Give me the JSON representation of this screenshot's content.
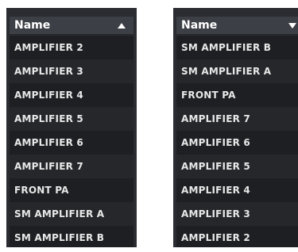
{
  "left_list": {
    "header_label": "Name",
    "sort": "ascending",
    "items": [
      "AMPLIFIER 2",
      "AMPLIFIER 3",
      "AMPLIFIER 4",
      "AMPLIFIER 5",
      "AMPLIFIER 6",
      "AMPLIFIER 7",
      "FRONT PA",
      "SM AMPLIFIER A",
      "SM AMPLIFIER B"
    ]
  },
  "right_list": {
    "header_label": "Name",
    "sort": "descending",
    "items": [
      "SM AMPLIFIER B",
      "SM AMPLIFIER A",
      "FRONT PA",
      "AMPLIFIER 7",
      "AMPLIFIER 6",
      "AMPLIFIER 5",
      "AMPLIFIER 4",
      "AMPLIFIER 3",
      "AMPLIFIER 2"
    ]
  },
  "colors": {
    "panel_background": "#2a2c31",
    "header_background": "#3c3f45",
    "row_odd": "#1d1f22",
    "row_even": "#25272b",
    "text": "#e8e8e8"
  }
}
